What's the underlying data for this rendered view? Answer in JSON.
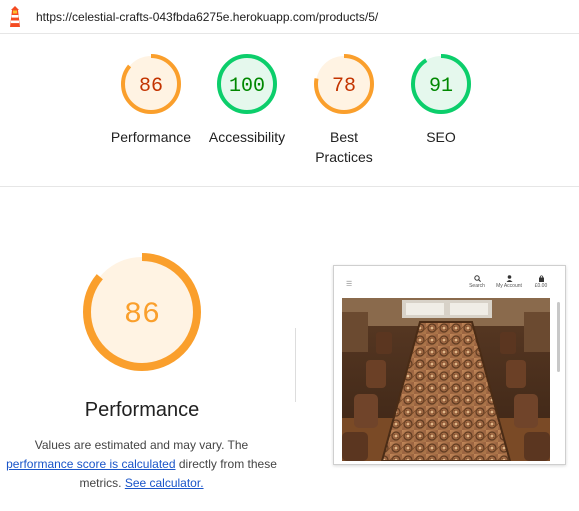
{
  "header": {
    "url": "https://celestial-crafts-043fbda6275e.herokuapp.com/products/5/"
  },
  "gauges": [
    {
      "score": "86",
      "label": "Performance",
      "value": 0.86,
      "color": "#fa9f2c",
      "text_color": "#c33300",
      "bg": "#fff3e3"
    },
    {
      "score": "100",
      "label": "Accessibility",
      "value": 1.0,
      "color": "#0cce6b",
      "text_color": "#008800",
      "bg": "#e5f8ed"
    },
    {
      "score": "78",
      "label_line1": "Best",
      "label_line2": "Practices",
      "value": 0.78,
      "color": "#fa9f2c",
      "text_color": "#c33300",
      "bg": "#fff3e3"
    },
    {
      "score": "91",
      "label": "SEO",
      "value": 0.91,
      "color": "#0cce6b",
      "text_color": "#008800",
      "bg": "#e5f8ed"
    }
  ],
  "main": {
    "score": "86",
    "value": 0.86,
    "title": "Performance",
    "note_part1": "Values are estimated and may vary. The",
    "link_score": "performance score is calculated",
    "note_part2": "directly from these metrics.",
    "link_calculator": "See calculator."
  },
  "screenshot": {
    "nav_search": "Search",
    "nav_account": "My Account",
    "nav_cart": "£0.00"
  }
}
